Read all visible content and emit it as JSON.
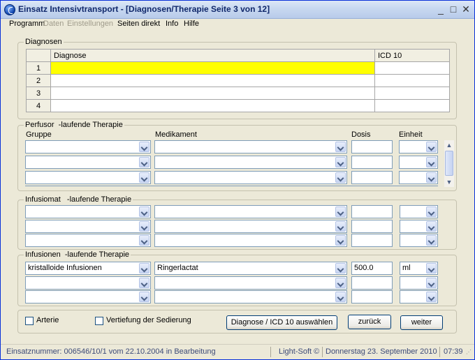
{
  "window": {
    "title": "Einsatz Intensivtransport - [Diagnosen/Therapie Seite 3 von 12]",
    "minimize": "_",
    "maximize": "□",
    "close": "✕"
  },
  "menu": [
    "Programm",
    "Daten",
    "Einstellungen",
    "Seiten direkt",
    "Info",
    "Hilfe"
  ],
  "diagnosen": {
    "legend": "Diagnosen",
    "columns": [
      "Diagnose",
      "ICD 10"
    ],
    "rows": [
      {
        "num": "1",
        "diagnose": "",
        "icd": ""
      },
      {
        "num": "2",
        "diagnose": "",
        "icd": ""
      },
      {
        "num": "3",
        "diagnose": "",
        "icd": ""
      },
      {
        "num": "4",
        "diagnose": "",
        "icd": ""
      }
    ]
  },
  "perfusor": {
    "legend": "Perfusor  -laufende Therapie",
    "col_gruppe": "Gruppe",
    "col_medikament": "Medikament",
    "col_dosis": "Dosis",
    "col_einheit": "Einheit"
  },
  "infusiomat": {
    "legend": "Infusiomat   -laufende Therapie"
  },
  "infusionen": {
    "legend": "Infusionen  -laufende Therapie",
    "row1": {
      "gruppe": "kristalloide Infusionen",
      "medikament": "Ringerlactat",
      "dosis": "500.0",
      "einheit": "ml"
    }
  },
  "bottom": {
    "arterie_label": "Arterie",
    "sedierung_label": "Vertiefung der Sedierung",
    "diagnose_button": "Diagnose / ICD 10 auswählen",
    "zurueck_button": "zurück",
    "weiter_button": "weiter"
  },
  "status": {
    "einsatz": "Einsatznummer: 006546/10/1 vom 22.10.2004 in Bearbeitung",
    "vendor": "Light-Soft ©",
    "date": "Donnerstag  23. September  2010",
    "time": "07:39"
  }
}
